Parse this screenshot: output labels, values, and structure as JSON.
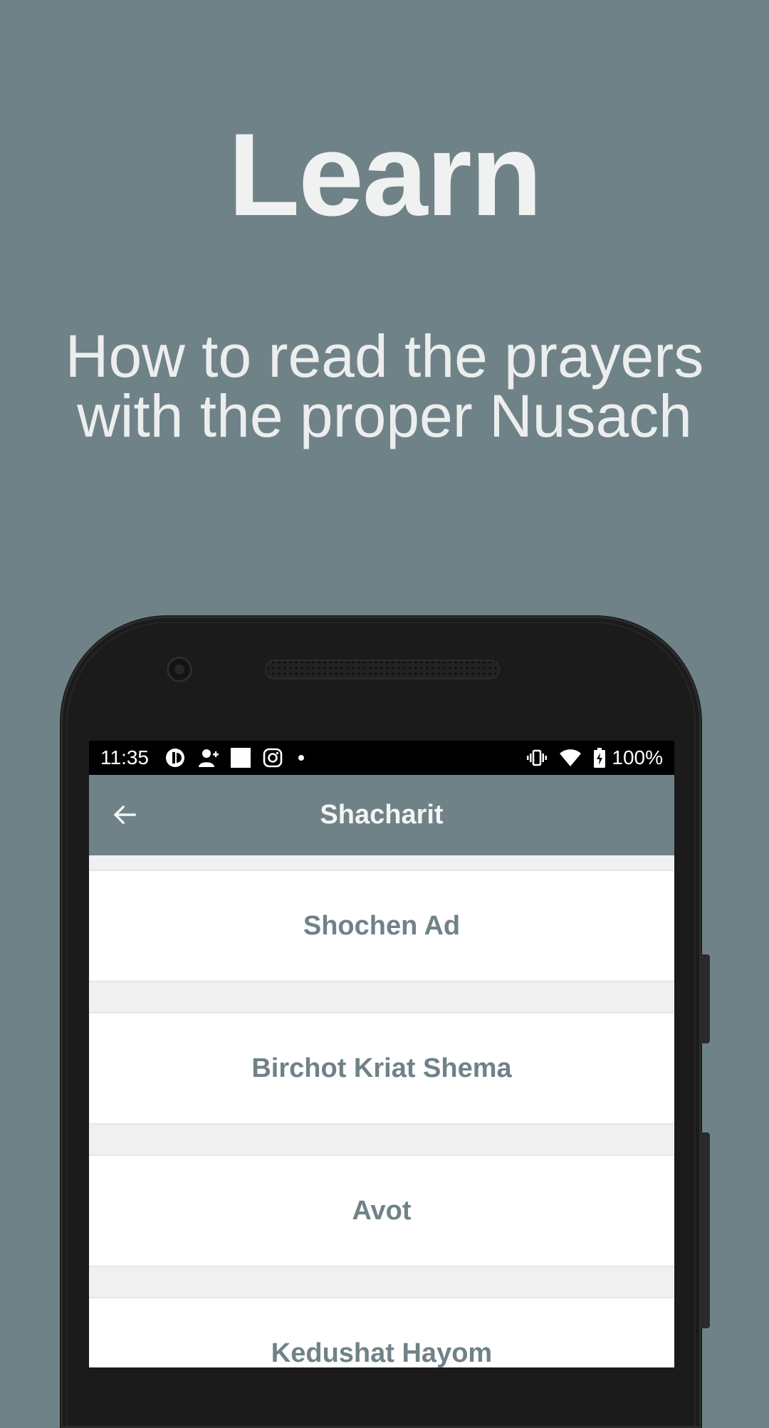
{
  "promo": {
    "headline": "Learn",
    "subtitle_line1": "How to read the prayers",
    "subtitle_line2": "with the proper Nusach"
  },
  "status_bar": {
    "time": "11:35",
    "battery_percent": "100%",
    "icons": [
      "shield-icon",
      "add-person-icon",
      "white-square-icon",
      "instagram-icon",
      "dot-icon",
      "vibrate-icon",
      "wifi-icon",
      "battery-charging-icon"
    ]
  },
  "app_bar": {
    "title": "Shacharit",
    "back_icon": "arrow-left-icon"
  },
  "list": {
    "items": [
      {
        "label": "Shochen Ad"
      },
      {
        "label": "Birchot Kriat Shema"
      },
      {
        "label": "Avot"
      },
      {
        "label": "Kedushat Hayom"
      }
    ]
  },
  "colors": {
    "background": "#6f8287",
    "accent_text": "#6f8287",
    "list_background": "#f0f0f0"
  }
}
